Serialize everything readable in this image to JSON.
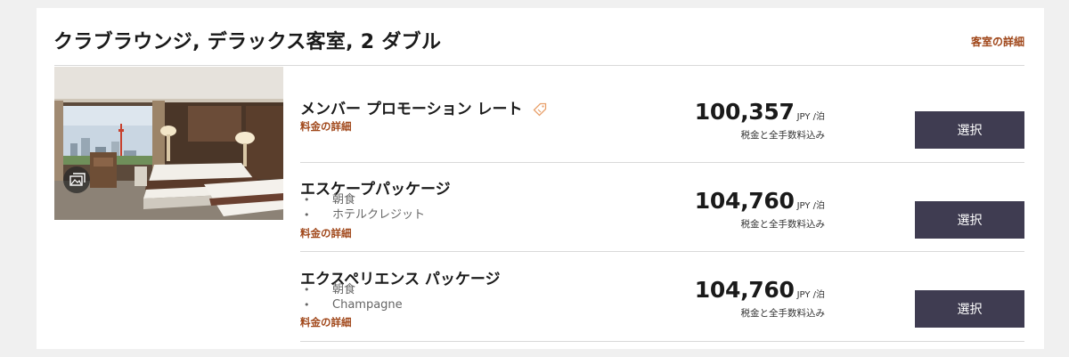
{
  "room": {
    "title": "クラブラウンジ, デラックス客室, 2 ダブル",
    "details_link": "客室の詳細"
  },
  "rates": [
    {
      "name": "メンバー プロモーション レート",
      "has_promo_icon": true,
      "inclusions": [],
      "details_link": "料金の詳細",
      "price": "100,357",
      "unit": "JPY /泊",
      "note": "税金と全手数料込み",
      "select_label": "選択"
    },
    {
      "name": "エスケープパッケージ",
      "has_promo_icon": false,
      "inclusions": [
        "朝食",
        "ホテルクレジット"
      ],
      "details_link": "料金の詳細",
      "price": "104,760",
      "unit": "JPY /泊",
      "note": "税金と全手数料込み",
      "select_label": "選択"
    },
    {
      "name": "エクスペリエンス パッケージ",
      "has_promo_icon": false,
      "inclusions": [
        "朝食",
        "Champagne"
      ],
      "details_link": "料金の詳細",
      "price": "104,760",
      "unit": "JPY /泊",
      "note": "税金と全手数料込み",
      "select_label": "選択"
    }
  ],
  "icons": {
    "gallery": "gallery-icon",
    "promo": "promo-tag-icon"
  },
  "colors": {
    "accent_link": "#a0471a",
    "select_button": "#3f3c51"
  }
}
